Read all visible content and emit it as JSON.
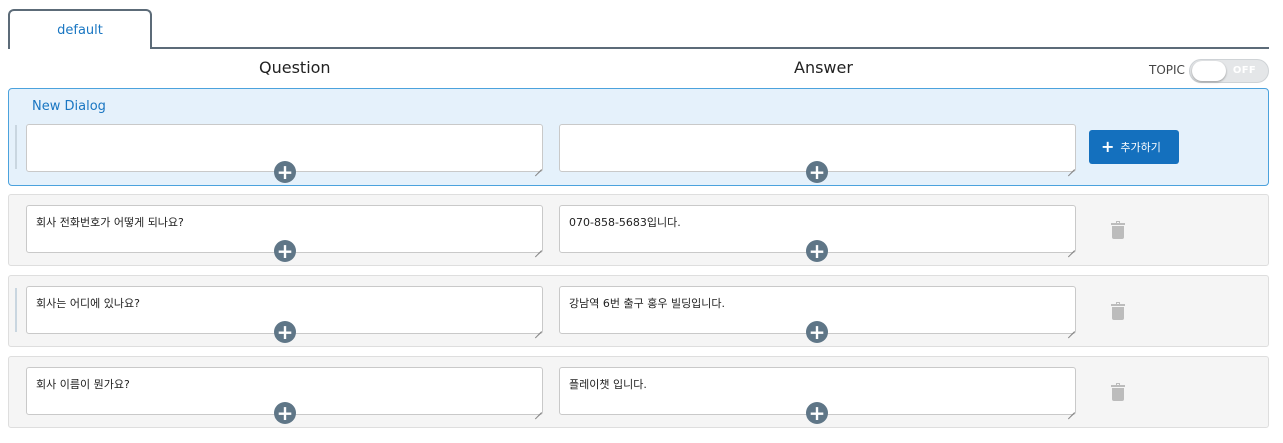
{
  "tabs": [
    {
      "label": "default"
    }
  ],
  "headers": {
    "question": "Question",
    "answer": "Answer"
  },
  "topic": {
    "label": "TOPIC",
    "state": "OFF"
  },
  "new_dialog": {
    "title": "New Dialog",
    "question": "",
    "answer": "",
    "add_button": "추가하기"
  },
  "dialogs": [
    {
      "question": "회사 전화번호가 어떻게 되나요?",
      "answer": "070-858-5683입니다."
    },
    {
      "question": "회사는 어디에 있나요?",
      "answer": "강남역 6번 출구 홍우 빌딩입니다."
    },
    {
      "question": "회사 이름이 뭔가요?",
      "answer": "플레이챗 입니다."
    }
  ],
  "icons": {
    "add": "plus-circle-icon",
    "delete": "trash-icon"
  },
  "colors": {
    "accent": "#1470be",
    "panel_bg": "#e5f1fb",
    "panel_border": "#4ba2dd",
    "plus_bg": "#5f7687"
  }
}
